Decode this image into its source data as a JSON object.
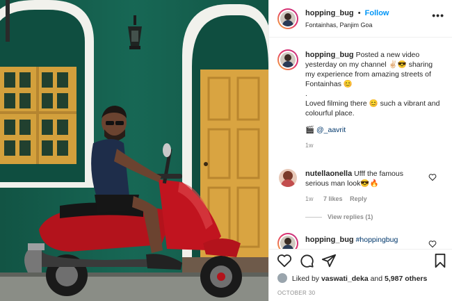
{
  "header": {
    "username": "hopping_bug",
    "separator": "•",
    "follow_label": "Follow",
    "location": "Fontainhas, Panjim Goa",
    "more_label": "•••"
  },
  "caption": {
    "username": "hopping_bug",
    "line1": "Posted a new video yesterday on my channel ✌🏻😎 sharing my experience from amazing streets of Fontainhas 😊",
    "line2": ".",
    "line3": "Loved filming there 😊 such a vibrant and colourful place.",
    "credit_icon": "🎬",
    "credit_mention": "@_aavrit",
    "time": "1w"
  },
  "comments": [
    {
      "username": "nutellaonella",
      "text": "Ufff the famous serious man look😎🔥",
      "time": "1w",
      "likes": "7 likes",
      "reply_label": "Reply",
      "view_replies": "View replies (1)"
    },
    {
      "username": "hopping_bug",
      "text": "#hoppingbug"
    }
  ],
  "footer": {
    "liked_by_prefix": "Liked by",
    "liked_by_user": "vaswati_deka",
    "and_label": "and",
    "others_label": "5,987 others",
    "date": "OCTOBER 30"
  },
  "icons": {
    "like": "heart-icon",
    "comment": "comment-icon",
    "share": "share-icon",
    "save": "bookmark-icon",
    "more": "more-options-icon"
  },
  "colors": {
    "follow": "#0095f6",
    "wall_green": "#14614f",
    "door_yellow": "#d9a441",
    "scooter_red": "#b3131c"
  }
}
